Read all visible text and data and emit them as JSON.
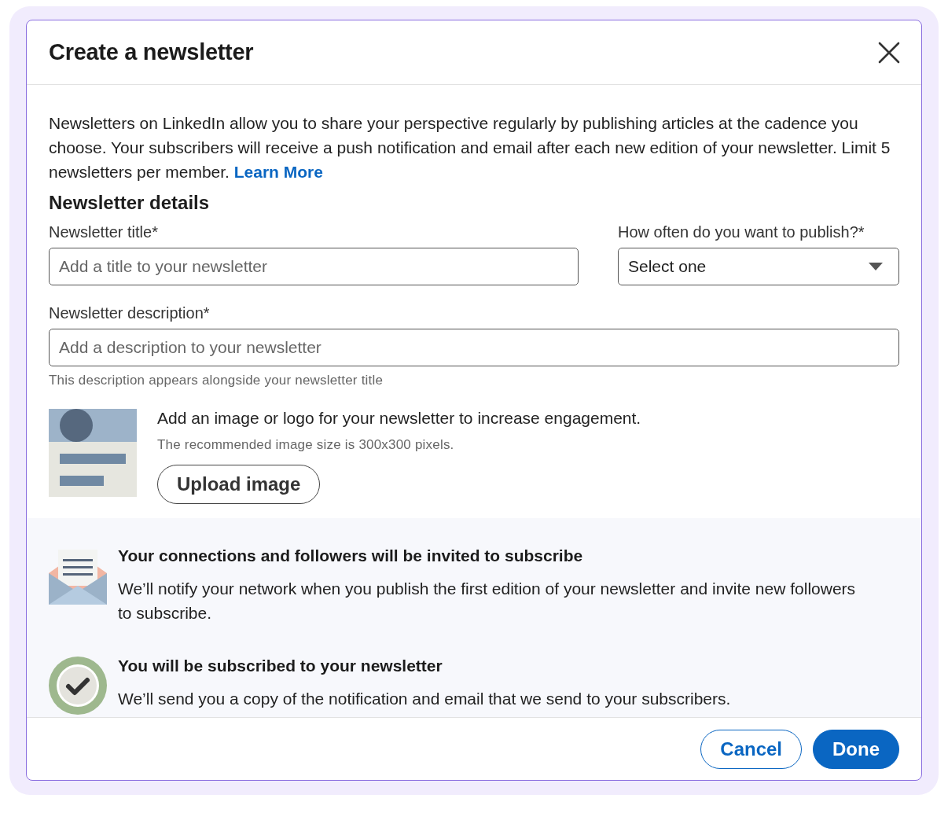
{
  "dialog": {
    "title": "Create a newsletter"
  },
  "intro": {
    "text": "Newsletters on LinkedIn allow you to share your perspective regularly by publishing articles at the cadence you choose. Your subscribers will receive a push notification and email after each new edition of your newsletter. Limit 5 newsletters per member.",
    "link": "Learn More"
  },
  "section_title": "Newsletter details",
  "title_field": {
    "label": "Newsletter title*",
    "placeholder": "Add a title to your newsletter"
  },
  "frequency_field": {
    "label": "How often do you want to publish?*",
    "value": "Select one"
  },
  "description_field": {
    "label": "Newsletter description*",
    "placeholder": "Add a description to your newsletter",
    "hint": "This description appears alongside your newsletter title"
  },
  "image_upload": {
    "heading": "Add an image or logo for your newsletter to increase engagement.",
    "note": "The recommended image size is 300x300 pixels.",
    "button": "Upload image"
  },
  "info_items": [
    {
      "kind": "envelope",
      "title": "Your connections and followers will be invited to subscribe",
      "text": "We’ll notify your network when you publish the first edition of your newsletter and invite new followers to subscribe."
    },
    {
      "kind": "check",
      "title": "You will be subscribed to your newsletter",
      "text": "We’ll send you a copy of the notification and email that we send to your subscribers."
    }
  ],
  "buttons": [
    {
      "label": "Cancel",
      "kind": "secondary"
    },
    {
      "label": "Done",
      "kind": "primary"
    }
  ]
}
